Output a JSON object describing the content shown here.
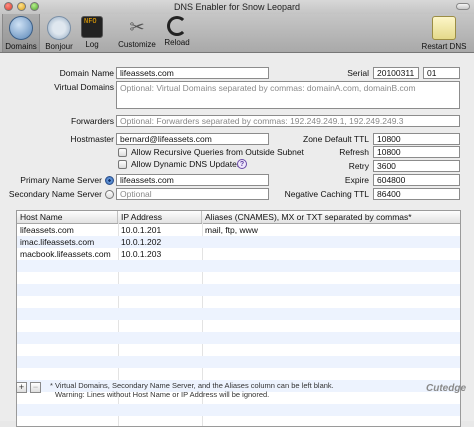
{
  "window": {
    "title": "DNS Enabler for Snow Leopard"
  },
  "toolbar": {
    "items": [
      {
        "label": "Domains",
        "icon": "globe-icon"
      },
      {
        "label": "Bonjour",
        "icon": "bonjour-icon"
      },
      {
        "label": "Log",
        "icon": "log-icon",
        "glyph": "NFO"
      },
      {
        "label": "Customize",
        "icon": "tools-icon"
      },
      {
        "label": "Reload",
        "icon": "reload-icon"
      },
      {
        "label": "Restart DNS",
        "icon": "restart-icon"
      }
    ]
  },
  "form": {
    "domain_name_label": "Domain Name",
    "domain_name_value": "lifeassets.com",
    "serial_label": "Serial",
    "serial_value": "20100311",
    "serial_suffix": "01",
    "virtual_domains_label": "Virtual Domains",
    "virtual_domains_placeholder": "Optional: Virtual Domains separated by commas: domainA.com, domainB.com",
    "forwarders_label": "Forwarders",
    "forwarders_placeholder": "Optional: Forwarders separated by commas: 192.249.249.1, 192.249.249.3",
    "hostmaster_label": "Hostmaster",
    "hostmaster_value": "bernard@lifeassets.com",
    "zone_ttl_label": "Zone Default TTL",
    "zone_ttl_value": "10800",
    "allow_recursive_label": "Allow Recursive Queries from Outside Subnet",
    "allow_dynamic_label": "Allow Dynamic DNS Updates",
    "help_glyph": "?",
    "refresh_label": "Refresh",
    "refresh_value": "10800",
    "retry_label": "Retry",
    "retry_value": "3600",
    "primary_ns_label": "Primary Name Server",
    "primary_ns_value": "lifeassets.com",
    "expire_label": "Expire",
    "expire_value": "604800",
    "secondary_ns_label": "Secondary Name Server",
    "secondary_ns_placeholder": "Optional",
    "neg_ttl_label": "Negative Caching TTL",
    "neg_ttl_value": "86400"
  },
  "table": {
    "columns": [
      "Host Name",
      "IP Address",
      "Aliases (CNAMES), MX or TXT separated by commas*"
    ],
    "rows": [
      [
        "lifeassets.com",
        "10.0.1.201",
        "mail, ftp, www"
      ],
      [
        "imac.lifeassets.com",
        "10.0.1.202",
        ""
      ],
      [
        "macbook.lifeassets.com",
        "10.0.1.203",
        ""
      ]
    ]
  },
  "footer": {
    "add_label": "+",
    "remove_label": "−",
    "note_line1": "* Virtual Domains, Secondary Name Server, and the Aliases column can be left blank.",
    "note_line2": "Warning: Lines without Host Name or IP Address will be ignored.",
    "brand": "Cutedge"
  }
}
